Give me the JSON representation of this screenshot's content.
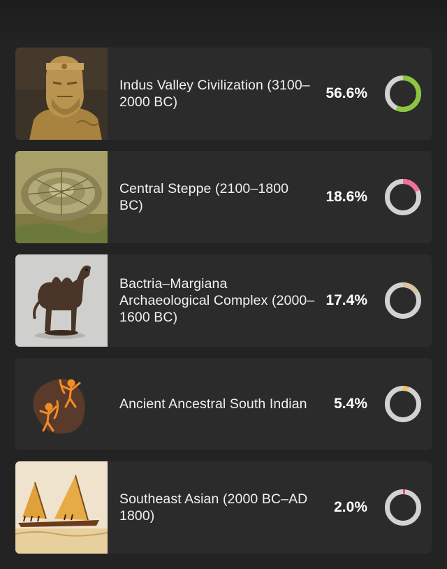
{
  "ring_track_color": "#d2d2d2",
  "items": [
    {
      "title": "Indus Valley Civilization (3100–2000 BC)",
      "percent_label": "56.6%",
      "percent": 56.6,
      "ring_color": "#8cc63f",
      "image_icon": "stone-bust-image"
    },
    {
      "title": "Central Steppe (2100–1800 BC)",
      "percent_label": "18.6%",
      "percent": 18.6,
      "ring_color": "#f0709c",
      "image_icon": "circular-fortress-image"
    },
    {
      "title": "Bactria–Margiana Archaeological Complex (2000–1600 BC)",
      "percent_label": "17.4%",
      "percent": 17.4,
      "ring_color": "#d6c4a3",
      "image_icon": "bronze-camel-image"
    },
    {
      "title": "Ancient Ancestral South Indian",
      "percent_label": "5.4%",
      "percent": 5.4,
      "ring_color": "#f2c45c",
      "image_icon": "rock-art-archers-image"
    },
    {
      "title": "Southeast Asian (2000 BC–AD 1800)",
      "percent_label": "2.0%",
      "percent": 2.0,
      "ring_color": "#ee3f8e",
      "image_icon": "sailing-canoe-image"
    }
  ]
}
